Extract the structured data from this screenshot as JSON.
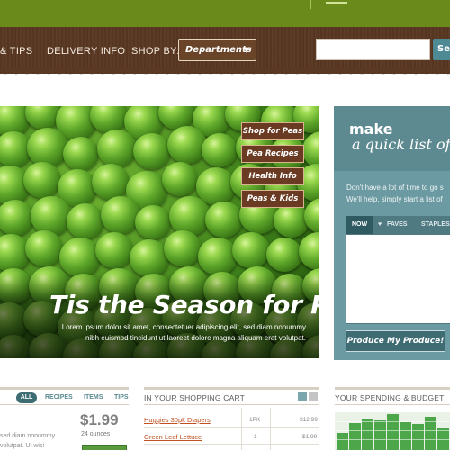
{
  "nav": {
    "links": [
      "& TIPS",
      "DELIVERY INFO",
      "SHOP BY:"
    ],
    "departments_label": "Departments",
    "search_button": "Sea"
  },
  "hero": {
    "title": "Tis the Season for Peas",
    "body": "Lorem ipsum dolor sit amet, consectetuer adipiscing elit, sed diam nonummy nibh euismod tincidunt ut laoreet dolore magna aliquam erat volutpat.",
    "tabs": [
      "Shop for Peas",
      "Pea Recipes",
      "Health Info",
      "Peas & Kids"
    ]
  },
  "quick_list": {
    "make": "make",
    "title": "a quick list of",
    "text_line1": "Don't have a lot of time to go s",
    "text_line2": "We'll help, simply start a list of",
    "tabs": [
      "NOW",
      "FAVES",
      "STAPLES"
    ],
    "active_tab": "NOW",
    "button": "Produce My Produce!"
  },
  "recipes_panel": {
    "filters": [
      "ALL",
      "RECIPES",
      "ITEMS",
      "TIPS"
    ],
    "price": "$1.99",
    "size": "24 ounces",
    "lorem_line1": "sed diam nonummy",
    "lorem_line2": "volutpat.  Ut wisi"
  },
  "cart": {
    "title": "IN YOUR SHOPPING CART",
    "items": [
      {
        "name": "Huggies 30pk Diapers",
        "qty": "1PK",
        "price": "$12.99"
      },
      {
        "name": "Green Leaf Lettuce",
        "qty": "1",
        "price": "$1.99"
      }
    ]
  },
  "spending": {
    "title": "YOUR SPENDING & BUDGET",
    "bar_levels": [
      0.45,
      0.72,
      0.82,
      0.78,
      0.95,
      0.74,
      0.68,
      0.88,
      0.6
    ],
    "bar_color": "#4da64a"
  },
  "colors": {
    "top_green": "#6b8a1c",
    "nav_brown": "#5a3823",
    "teal": "#6c9aa2",
    "accent_orange": "#c0501f"
  }
}
